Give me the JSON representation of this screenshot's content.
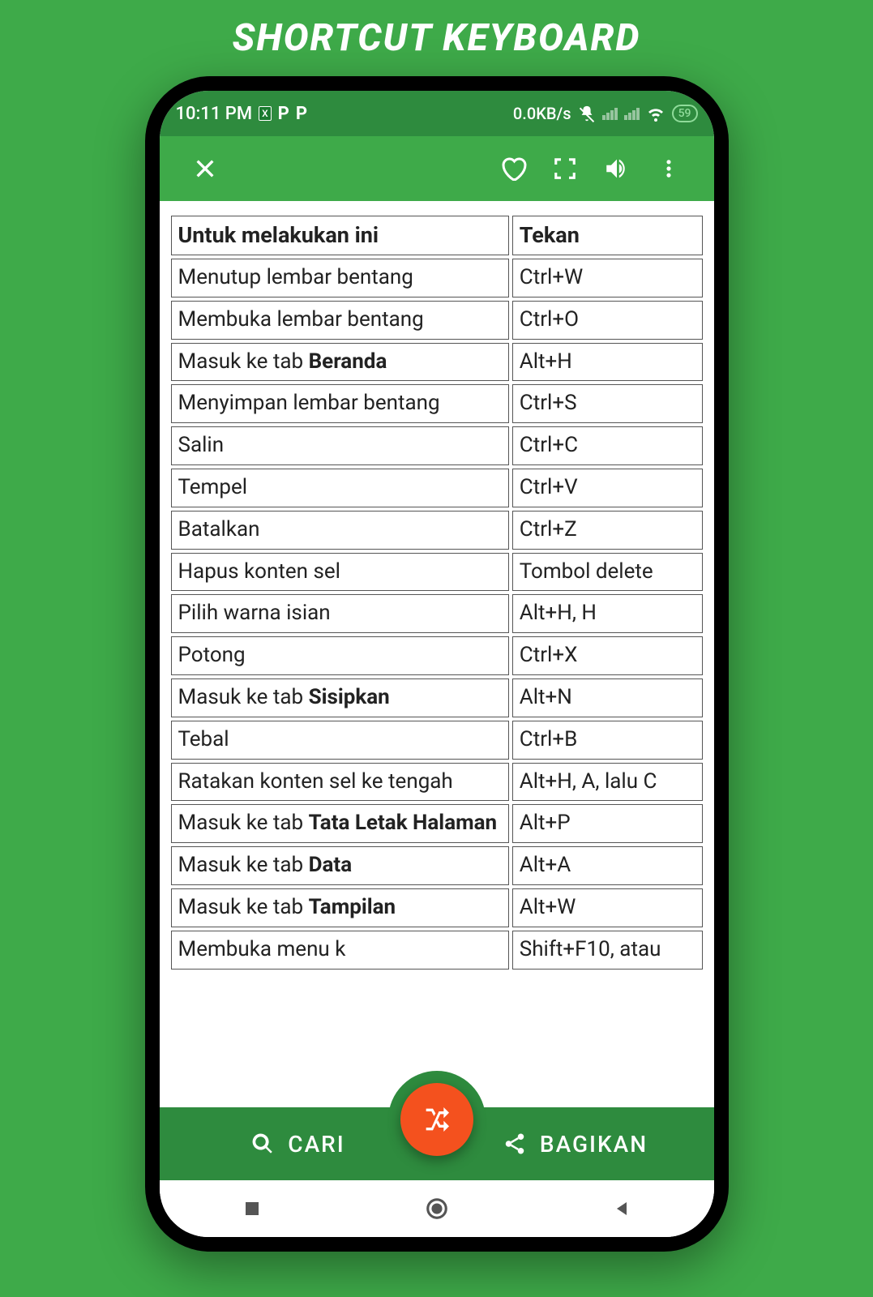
{
  "page_heading": "SHORTCUT KEYBOARD",
  "status": {
    "time": "10:11 PM",
    "net_speed": "0.0KB/s",
    "battery": "59"
  },
  "table": {
    "header": {
      "col1": "Untuk melakukan ini",
      "col2": "Tekan"
    },
    "rows": [
      {
        "action_pre": "Menutup lembar bentang",
        "action_bold": "",
        "key": "Ctrl+W"
      },
      {
        "action_pre": "Membuka lembar bentang",
        "action_bold": "",
        "key": "Ctrl+O"
      },
      {
        "action_pre": "Masuk ke tab ",
        "action_bold": "Beranda",
        "key": "Alt+H"
      },
      {
        "action_pre": "Menyimpan lembar bentang",
        "action_bold": "",
        "key": "Ctrl+S"
      },
      {
        "action_pre": "Salin",
        "action_bold": "",
        "key": "Ctrl+C"
      },
      {
        "action_pre": "Tempel",
        "action_bold": "",
        "key": "Ctrl+V"
      },
      {
        "action_pre": "Batalkan",
        "action_bold": "",
        "key": "Ctrl+Z"
      },
      {
        "action_pre": "Hapus konten sel",
        "action_bold": "",
        "key": "Tombol delete"
      },
      {
        "action_pre": "Pilih warna isian",
        "action_bold": "",
        "key": "Alt+H, H"
      },
      {
        "action_pre": "Potong",
        "action_bold": "",
        "key": "Ctrl+X"
      },
      {
        "action_pre": "Masuk ke tab ",
        "action_bold": "Sisipkan",
        "key": "Alt+N"
      },
      {
        "action_pre": "Tebal",
        "action_bold": "",
        "key": "Ctrl+B"
      },
      {
        "action_pre": "Ratakan konten sel ke tengah",
        "action_bold": "",
        "key": "Alt+H, A, lalu C"
      },
      {
        "action_pre": "Masuk ke tab ",
        "action_bold": "Tata Letak Halaman",
        "key": "Alt+P"
      },
      {
        "action_pre": "Masuk ke tab ",
        "action_bold": "Data",
        "key": "Alt+A"
      },
      {
        "action_pre": "Masuk ke tab ",
        "action_bold": "Tampilan",
        "key": "Alt+W"
      },
      {
        "action_pre": "Membuka menu k",
        "action_bold": "",
        "key": "Shift+F10, atau"
      }
    ]
  },
  "bottom": {
    "search": "CARI",
    "share": "BAGIKAN"
  }
}
